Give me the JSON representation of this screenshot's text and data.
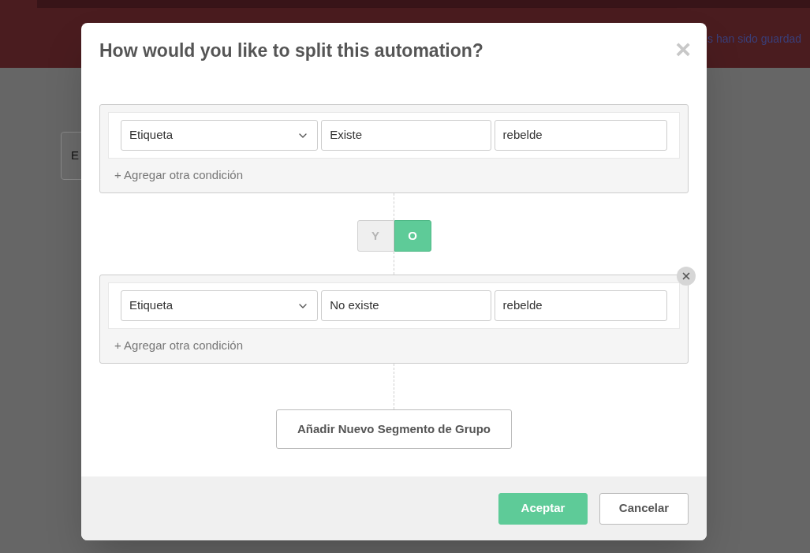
{
  "background": {
    "notice": "s han sido guardad",
    "card_label": "E"
  },
  "dialog": {
    "title": "How would you like to split this automation?",
    "close": "×",
    "groups": [
      {
        "removable": false,
        "conditions": [
          {
            "field": "Etiqueta",
            "operator": "Existe",
            "value": "rebelde"
          }
        ],
        "add_link": "+ Agregar otra condición"
      },
      {
        "removable": true,
        "conditions": [
          {
            "field": "Etiqueta",
            "operator": "No existe",
            "value": "rebelde"
          }
        ],
        "add_link": "+ Agregar otra condición"
      }
    ],
    "logic": [
      {
        "label": "Y",
        "selected": false
      },
      {
        "label": "O",
        "selected": true
      }
    ],
    "add_segment": "Añadir Nuevo Segmento de Grupo",
    "buttons": [
      {
        "label": "Aceptar",
        "kind": "primary"
      },
      {
        "label": "Cancelar",
        "kind": "secondary"
      }
    ]
  }
}
